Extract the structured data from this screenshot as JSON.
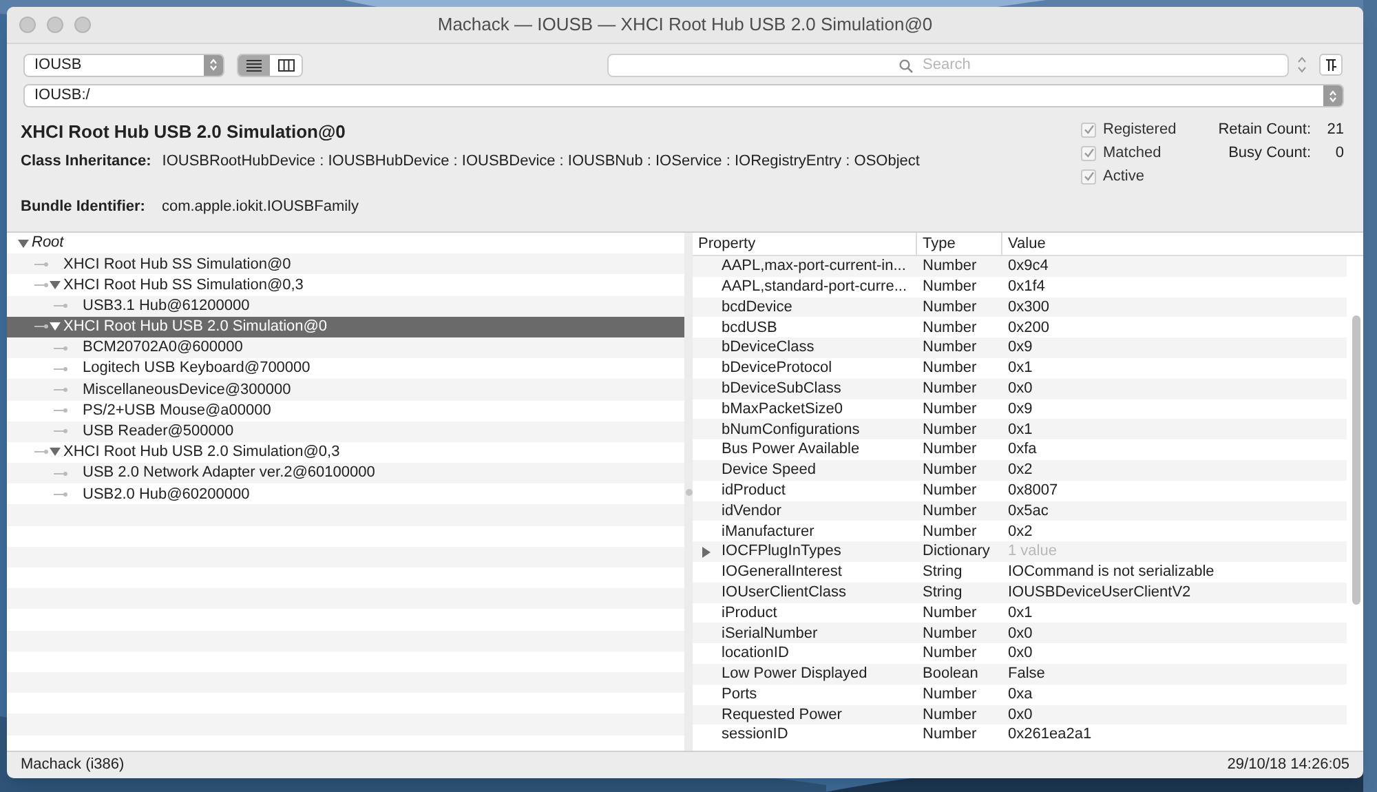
{
  "window": {
    "title": "Machack — IOUSB — XHCI Root Hub USB 2.0 Simulation@0"
  },
  "toolbar": {
    "plane": "IOUSB",
    "views": [
      {
        "kind": "list",
        "selected": true
      },
      {
        "kind": "columns",
        "selected": false
      }
    ],
    "search": {
      "placeholder": "Search"
    },
    "path": "IOUSB:/"
  },
  "object": {
    "name": "XHCI Root Hub USB 2.0 Simulation@0",
    "class_label": "Class Inheritance:",
    "class_value": "IOUSBRootHubDevice : IOUSBHubDevice : IOUSBDevice : IOUSBNub : IOService : IORegistryEntry : OSObject",
    "bundle_label": "Bundle Identifier:",
    "bundle_value": "com.apple.iokit.IOUSBFamily",
    "flags": [
      {
        "label": "Registered",
        "checked": true
      },
      {
        "label": "Matched",
        "checked": true
      },
      {
        "label": "Active",
        "checked": true
      }
    ],
    "counts": [
      {
        "label": "Retain Count:",
        "value": "21"
      },
      {
        "label": "Busy Count:",
        "value": "0"
      }
    ]
  },
  "tree": [
    {
      "label": "Root",
      "expanded": true,
      "selected": false,
      "children": [
        {
          "label": "XHCI Root Hub SS Simulation@0",
          "selected": false
        },
        {
          "label": "XHCI Root Hub SS Simulation@0,3",
          "expanded": true,
          "selected": false,
          "children": [
            {
              "label": "USB3.1 Hub@61200000",
              "selected": false
            }
          ]
        },
        {
          "label": "XHCI Root Hub USB 2.0 Simulation@0",
          "expanded": true,
          "selected": true,
          "children": [
            {
              "label": "BCM20702A0@600000",
              "selected": false
            },
            {
              "label": "Logitech USB Keyboard@700000",
              "selected": false
            },
            {
              "label": "MiscellaneousDevice@300000",
              "selected": false
            },
            {
              "label": "PS/2+USB Mouse@a00000",
              "selected": false
            },
            {
              "label": "USB Reader@500000",
              "selected": false
            }
          ]
        },
        {
          "label": "XHCI Root Hub USB 2.0 Simulation@0,3",
          "expanded": true,
          "selected": false,
          "children": [
            {
              "label": "USB 2.0 Network Adapter ver.2@60100000",
              "selected": false
            },
            {
              "label": "USB2.0 Hub@60200000",
              "selected": false
            }
          ]
        }
      ]
    }
  ],
  "properties": {
    "columns": [
      "Property",
      "Type",
      "Value"
    ],
    "rows": [
      {
        "kind": "value",
        "property": "AAPL,max-port-current-in...",
        "type": "Number",
        "value": "0x9c4"
      },
      {
        "kind": "value",
        "property": "AAPL,standard-port-curre...",
        "type": "Number",
        "value": "0x1f4"
      },
      {
        "kind": "value",
        "property": "bcdDevice",
        "type": "Number",
        "value": "0x300"
      },
      {
        "kind": "value",
        "property": "bcdUSB",
        "type": "Number",
        "value": "0x200"
      },
      {
        "kind": "value",
        "property": "bDeviceClass",
        "type": "Number",
        "value": "0x9"
      },
      {
        "kind": "value",
        "property": "bDeviceProtocol",
        "type": "Number",
        "value": "0x1"
      },
      {
        "kind": "value",
        "property": "bDeviceSubClass",
        "type": "Number",
        "value": "0x0"
      },
      {
        "kind": "value",
        "property": "bMaxPacketSize0",
        "type": "Number",
        "value": "0x9"
      },
      {
        "kind": "value",
        "property": "bNumConfigurations",
        "type": "Number",
        "value": "0x1"
      },
      {
        "kind": "value",
        "property": "Bus Power Available",
        "type": "Number",
        "value": "0xfa"
      },
      {
        "kind": "value",
        "property": "Device Speed",
        "type": "Number",
        "value": "0x2"
      },
      {
        "kind": "value",
        "property": "idProduct",
        "type": "Number",
        "value": "0x8007"
      },
      {
        "kind": "value",
        "property": "idVendor",
        "type": "Number",
        "value": "0x5ac"
      },
      {
        "kind": "value",
        "property": "iManufacturer",
        "type": "Number",
        "value": "0x2"
      },
      {
        "kind": "container",
        "expanded": false,
        "property": "IOCFPlugInTypes",
        "type": "Dictionary",
        "value": "1 value"
      },
      {
        "kind": "value",
        "property": "IOGeneralInterest",
        "type": "String",
        "value": "IOCommand is not serializable"
      },
      {
        "kind": "value",
        "property": "IOUserClientClass",
        "type": "String",
        "value": "IOUSBDeviceUserClientV2"
      },
      {
        "kind": "value",
        "property": "iProduct",
        "type": "Number",
        "value": "0x1"
      },
      {
        "kind": "value",
        "property": "iSerialNumber",
        "type": "Number",
        "value": "0x0"
      },
      {
        "kind": "value",
        "property": "locationID",
        "type": "Number",
        "value": "0x0"
      },
      {
        "kind": "value",
        "property": "Low Power Displayed",
        "type": "Boolean",
        "value": "False"
      },
      {
        "kind": "value",
        "property": "Ports",
        "type": "Number",
        "value": "0xa"
      },
      {
        "kind": "value",
        "property": "Requested Power",
        "type": "Number",
        "value": "0x0"
      },
      {
        "kind": "value",
        "property": "sessionID",
        "type": "Number",
        "value": "0x261ea2a1"
      }
    ]
  },
  "status_bar": {
    "left": "Machack (i386)",
    "right": "29/10/18 14:26:05"
  }
}
